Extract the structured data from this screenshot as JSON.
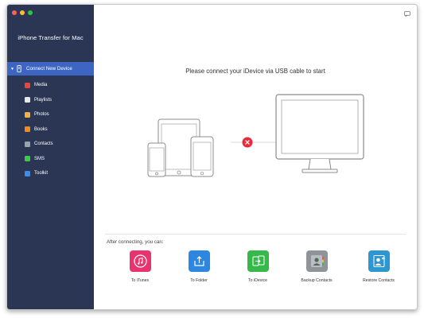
{
  "window": {
    "controls": [
      "close",
      "minimize",
      "zoom"
    ]
  },
  "sidebar": {
    "app_title": "iPhone Transfer for Mac",
    "header": {
      "label": "Connect New Device",
      "icon": "usb-device-icon"
    },
    "items": [
      {
        "label": "Media",
        "icon": "media-icon",
        "color": "#e8453c"
      },
      {
        "label": "Playlists",
        "icon": "playlists-icon",
        "color": "#e8e8e8"
      },
      {
        "label": "Photos",
        "icon": "photos-icon",
        "color": "#f4b13d"
      },
      {
        "label": "Books",
        "icon": "books-icon",
        "color": "#f08a24"
      },
      {
        "label": "Contacts",
        "icon": "contacts-icon",
        "color": "#9aa4ad"
      },
      {
        "label": "SMS",
        "icon": "sms-icon",
        "color": "#3fc94b"
      },
      {
        "label": "Toolkit",
        "icon": "toolkit-icon",
        "color": "#3a8ef0"
      }
    ],
    "colors": {
      "background": "#2b3654",
      "selected": "#3d66c4"
    }
  },
  "main": {
    "prompt": "Please connect your iDevice via USB cable to start",
    "connection_status_icon": "disconnected-icon",
    "after_connecting": "After connecting, you can:",
    "actions": [
      {
        "label": "To iTunes",
        "icon": "itunes-icon",
        "color": "#e8336e"
      },
      {
        "label": "To Folder",
        "icon": "folder-export-icon",
        "color": "#2b87e0"
      },
      {
        "label": "To iDevice",
        "icon": "idevice-transfer-icon",
        "color": "#36b84a"
      },
      {
        "label": "Backup Contacts",
        "icon": "backup-contacts-icon",
        "color": "#8e9499"
      },
      {
        "label": "Restore Contacts",
        "icon": "restore-contacts-icon",
        "color": "#2c97d1"
      }
    ]
  }
}
